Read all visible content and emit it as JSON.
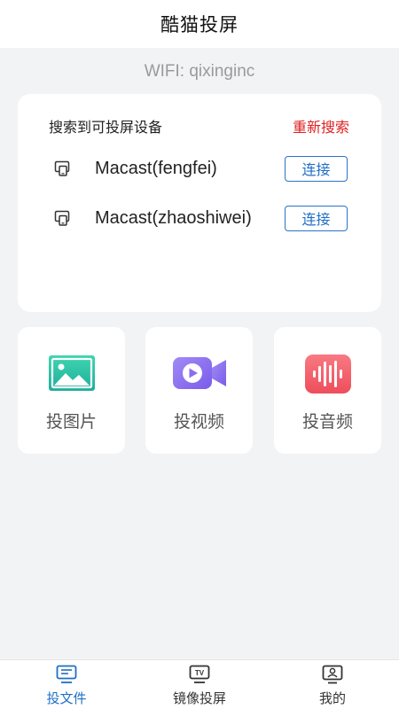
{
  "header": {
    "title": "酷猫投屏"
  },
  "wifi": {
    "text": "WIFI: qixinginc"
  },
  "devices": {
    "title": "搜索到可投屏设备",
    "rescan_label": "重新搜索",
    "items": [
      {
        "name": "Macast(fengfei)",
        "connect_label": "连接",
        "icon": "cast-device-icon"
      },
      {
        "name": "Macast(zhaoshiwei)",
        "connect_label": "连接",
        "icon": "cast-device-icon"
      }
    ]
  },
  "features": [
    {
      "label": "投图片",
      "icon": "image-icon",
      "color": "#2ec6a8"
    },
    {
      "label": "投视频",
      "icon": "video-camera-icon",
      "color": "#8b6cf0"
    },
    {
      "label": "投音频",
      "icon": "audio-wave-icon",
      "color": "#f2606b"
    }
  ],
  "bottom_nav": [
    {
      "label": "投文件",
      "icon": "cast-file-icon",
      "active": true
    },
    {
      "label": "镜像投屏",
      "icon": "tv-mirror-icon",
      "active": false
    },
    {
      "label": "我的",
      "icon": "profile-icon",
      "active": false
    }
  ],
  "colors": {
    "accent": "#1e6fc4",
    "rescan": "#e02020",
    "background": "#f2f3f5"
  }
}
